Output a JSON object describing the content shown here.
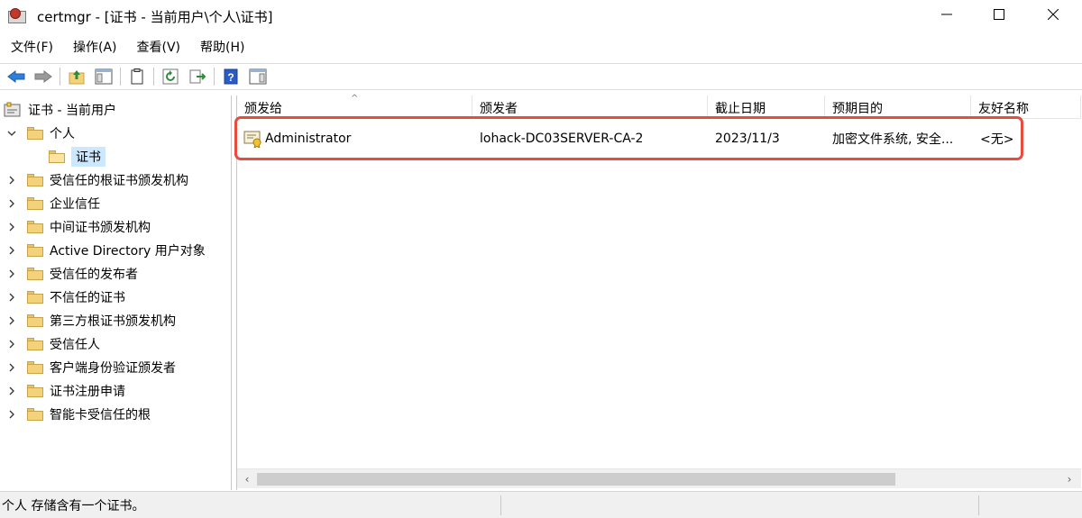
{
  "window": {
    "title": "certmgr - [证书 - 当前用户\\个人\\证书]"
  },
  "menu": [
    "文件(F)",
    "操作(A)",
    "查看(V)",
    "帮助(H)"
  ],
  "toolbar": {
    "icons": [
      "back-arrow-icon",
      "forward-arrow-icon",
      "up-folder-icon",
      "show-hide-tree-icon",
      "properties-icon",
      "refresh-icon",
      "export-list-icon",
      "help-icon",
      "show-hide-action-icon"
    ]
  },
  "tree": {
    "root": "证书 - 当前用户",
    "items": [
      {
        "label": "个人",
        "expanded": true
      },
      {
        "label": "证书",
        "selected": true
      },
      {
        "label": "受信任的根证书颁发机构"
      },
      {
        "label": "企业信任"
      },
      {
        "label": "中间证书颁发机构"
      },
      {
        "label": "Active Directory 用户对象"
      },
      {
        "label": "受信任的发布者"
      },
      {
        "label": "不信任的证书"
      },
      {
        "label": "第三方根证书颁发机构"
      },
      {
        "label": "受信任人"
      },
      {
        "label": "客户端身份验证颁发者"
      },
      {
        "label": "证书注册申请"
      },
      {
        "label": "智能卡受信任的根"
      }
    ]
  },
  "list": {
    "columns": [
      "颁发给",
      "颁发者",
      "截止日期",
      "预期目的",
      "友好名称"
    ],
    "rows": [
      {
        "issued_to": "Administrator",
        "issued_by": "lohack-DC03SERVER-CA-2",
        "expiration": "2023/11/3",
        "purposes": "加密文件系统, 安全...",
        "friendly_name": "<无>"
      }
    ]
  },
  "status": {
    "text": "个人 存储含有一个证书。"
  },
  "colors": {
    "highlight": "#e74c3c",
    "selection": "#cce8ff"
  }
}
